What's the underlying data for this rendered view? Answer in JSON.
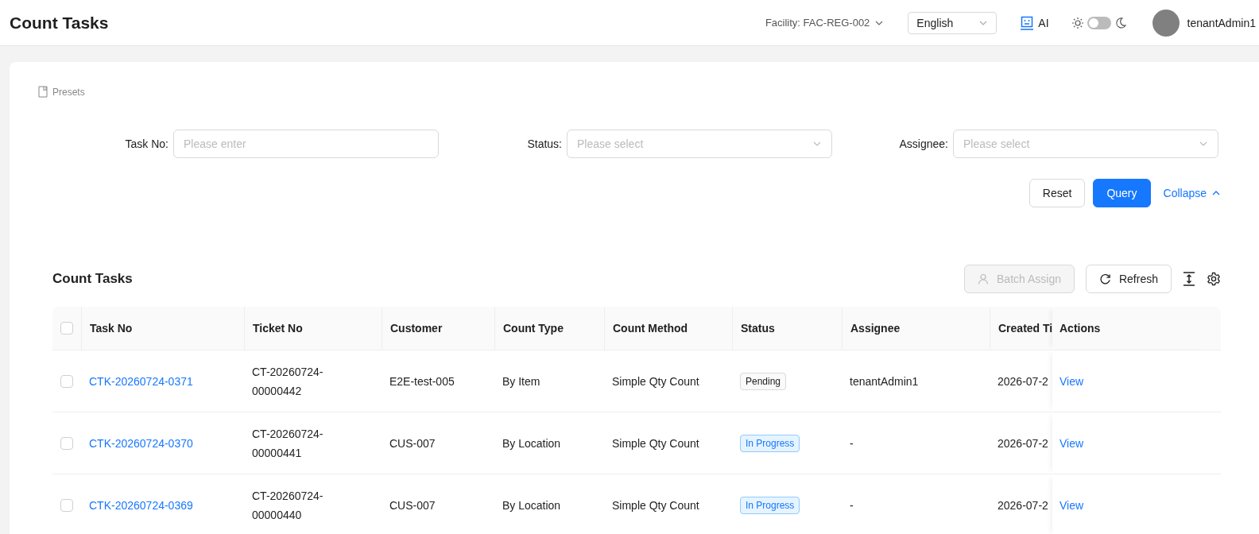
{
  "header": {
    "title": "Count Tasks",
    "facility": "Facility: FAC-REG-002",
    "language": "English",
    "ai": "AI",
    "dark_mode": {
      "on": false
    },
    "user": "tenantAdmin1"
  },
  "presets": "Presets",
  "filters": [
    {
      "label": "Task No:",
      "kind": "input",
      "placeholder": "Please enter"
    },
    {
      "label": "Status:",
      "kind": "select",
      "placeholder": "Please select"
    },
    {
      "label": "Assignee:",
      "kind": "select",
      "placeholder": "Please select"
    }
  ],
  "filter_actions": {
    "reset": "Reset",
    "query": "Query",
    "collapse": "Collapse"
  },
  "table": {
    "title": "Count Tasks",
    "batch_assign": {
      "label": "Batch Assign",
      "disabled": true
    },
    "refresh": "Refresh",
    "select_all": {
      "checked": false
    },
    "columns": [
      "Task No",
      "Ticket No",
      "Customer",
      "Count Type",
      "Count Method",
      "Status",
      "Assignee",
      "Created Ti",
      "Actions"
    ],
    "rows": [
      {
        "checked": false,
        "task_no": "CTK-20260724-0371",
        "ticket_no": "CT-20260724-00000442",
        "customer": "E2E-test-005",
        "count_type": "By Item",
        "count_method": "Simple Qty Count",
        "status": {
          "label": "Pending",
          "kind": "default"
        },
        "assignee": "tenantAdmin1",
        "created": "2026-07-2",
        "action": "View"
      },
      {
        "checked": false,
        "task_no": "CTK-20260724-0370",
        "ticket_no": "CT-20260724-00000441",
        "customer": "CUS-007",
        "count_type": "By Location",
        "count_method": "Simple Qty Count",
        "status": {
          "label": "In Progress",
          "kind": "processing"
        },
        "assignee": "-",
        "created": "2026-07-2",
        "action": "View"
      },
      {
        "checked": false,
        "task_no": "CTK-20260724-0369",
        "ticket_no": "CT-20260724-00000440",
        "customer": "CUS-007",
        "count_type": "By Location",
        "count_method": "Simple Qty Count",
        "status": {
          "label": "In Progress",
          "kind": "processing"
        },
        "assignee": "-",
        "created": "2026-07-2",
        "action": "View"
      }
    ]
  }
}
